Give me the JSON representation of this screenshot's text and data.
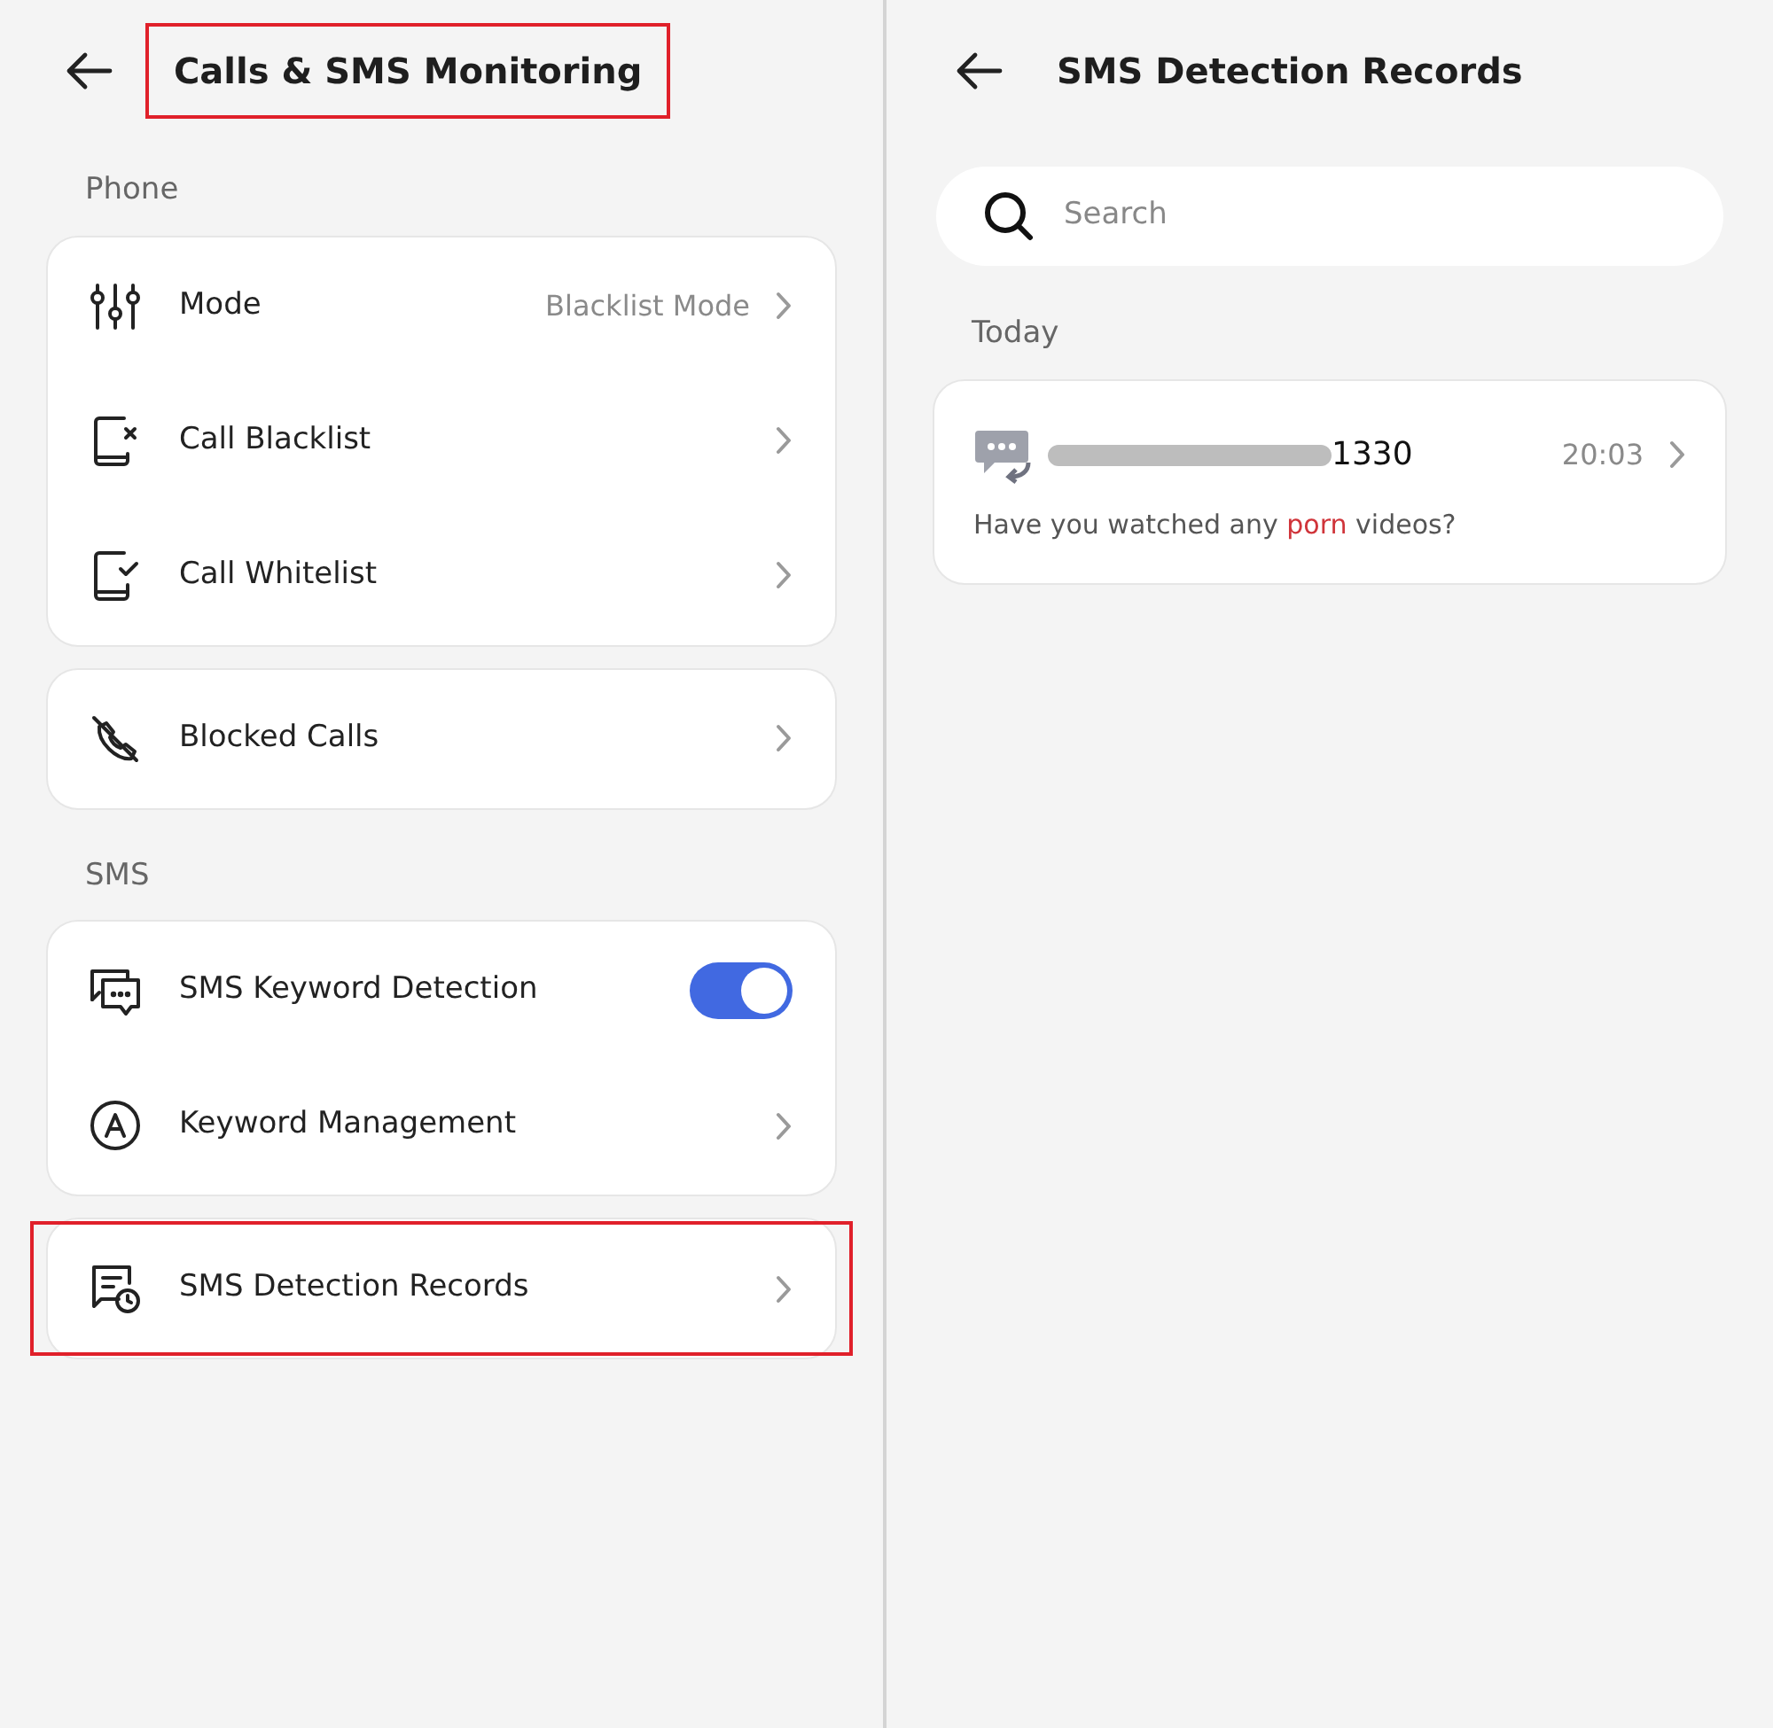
{
  "settings_screen": {
    "title": "Calls & SMS Monitoring",
    "title_annotated": true,
    "sections": [
      {
        "label": "Phone",
        "groups": [
          [
            {
              "kind": "link",
              "label": "Mode",
              "value": "Blacklist Mode",
              "annotated": false
            },
            {
              "kind": "link",
              "label": "Call Blacklist",
              "annotated": false
            },
            {
              "kind": "link",
              "label": "Call Whitelist",
              "annotated": false
            }
          ],
          [
            {
              "kind": "link",
              "label": "Blocked Calls",
              "annotated": false
            }
          ]
        ]
      },
      {
        "label": "SMS",
        "groups": [
          [
            {
              "kind": "toggle",
              "label": "SMS Keyword Detection",
              "on": true,
              "annotated": false
            },
            {
              "kind": "link",
              "label": "Keyword Management",
              "annotated": false
            }
          ],
          [
            {
              "kind": "link",
              "label": "SMS Detection Records",
              "annotated": true
            }
          ]
        ]
      }
    ]
  },
  "records_screen": {
    "title": "SMS Detection Records",
    "search": {
      "placeholder": "Search"
    },
    "groups": [
      {
        "label": "Today",
        "records": [
          {
            "sender_redacted": true,
            "sender": "1330",
            "time": "20:03",
            "message": [
              {
                "text": "Have you watched any ",
                "highlight": false
              },
              {
                "text": "porn",
                "highlight": true
              },
              {
                "text": " videos?",
                "highlight": false
              }
            ]
          }
        ]
      }
    ]
  }
}
